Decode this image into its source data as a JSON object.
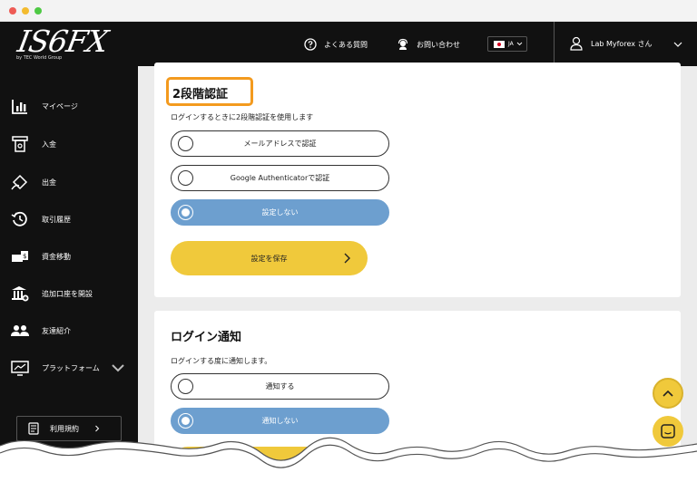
{
  "header": {
    "logo_text": "IS6FX",
    "logo_sub": "by TEC World Group",
    "faq_label": "よくある質問",
    "contact_label": "お問い合わせ",
    "lang_label": "JA",
    "user_label": "Lab Myforex さん"
  },
  "sidebar": {
    "items": [
      {
        "label": "マイページ",
        "icon": "chart-bars-icon"
      },
      {
        "label": "入金",
        "icon": "deposit-icon"
      },
      {
        "label": "出金",
        "icon": "withdraw-icon"
      },
      {
        "label": "取引履歴",
        "icon": "history-icon"
      },
      {
        "label": "資金移動",
        "icon": "transfer-icon"
      },
      {
        "label": "追加口座を開設",
        "icon": "bank-plus-icon"
      },
      {
        "label": "友達紹介",
        "icon": "users-icon"
      },
      {
        "label": "プラットフォーム",
        "icon": "monitor-icon"
      }
    ],
    "terms_label": "利用規約"
  },
  "two_factor": {
    "title": "2段階認証",
    "description": "ログインするときに2段階認証を使用します",
    "options": [
      {
        "label": "メールアドレスで認証",
        "selected": false
      },
      {
        "label": "Google Authenticatorで認証",
        "selected": false
      },
      {
        "label": "設定しない",
        "selected": true
      }
    ],
    "save_label": "設定を保存"
  },
  "login_notice": {
    "title": "ログイン通知",
    "description": "ログインする度に通知します。",
    "options": [
      {
        "label": "通知する",
        "selected": false
      },
      {
        "label": "通知しない",
        "selected": true
      }
    ]
  },
  "colors": {
    "accent_yellow": "#f0c93b",
    "selected_blue": "#6d9fcf",
    "highlight_orange": "#f39a1e",
    "dark": "#111111"
  }
}
